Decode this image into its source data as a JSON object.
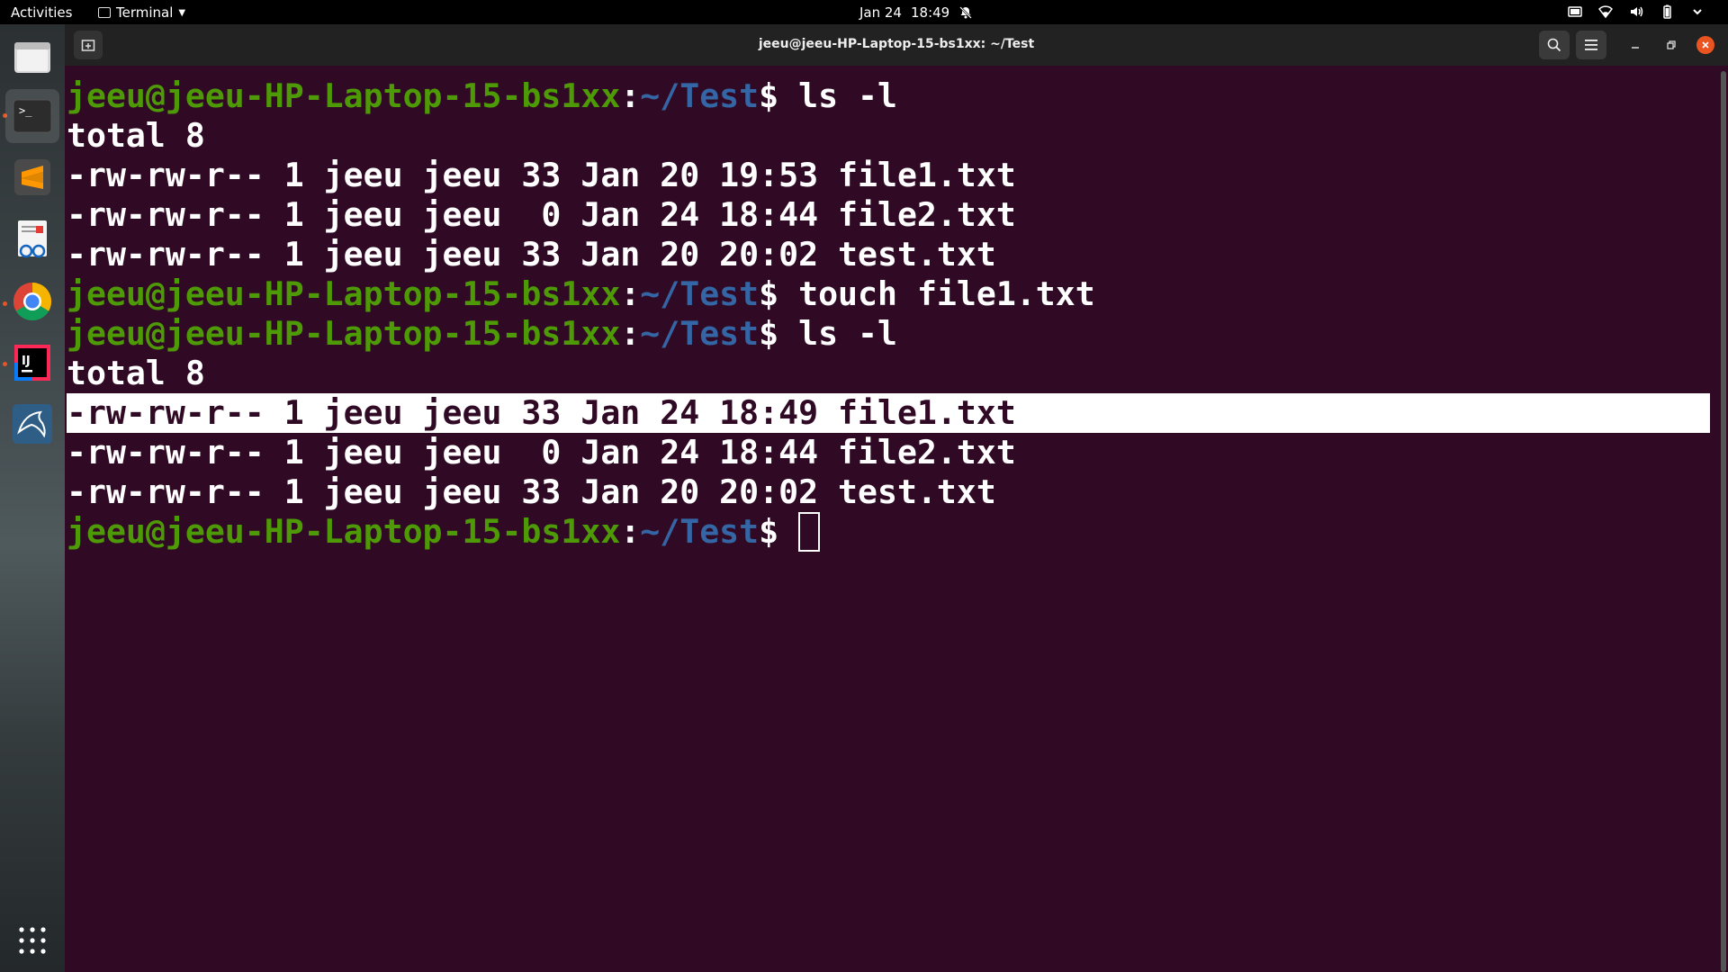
{
  "topbar": {
    "activities": "Activities",
    "app_name": "Terminal",
    "date": "Jan 24",
    "time": "18:49"
  },
  "dock": {
    "items": [
      {
        "name": "files",
        "icon": "folder-icon"
      },
      {
        "name": "terminal",
        "icon": "terminal-icon",
        "active": true
      },
      {
        "name": "sublime-text",
        "icon": "sublime-icon"
      },
      {
        "name": "document-viewer",
        "icon": "document-viewer-icon"
      },
      {
        "name": "chrome",
        "icon": "chrome-icon"
      },
      {
        "name": "intellij",
        "icon": "intellij-icon"
      },
      {
        "name": "mysql-workbench",
        "icon": "dolphin-icon"
      },
      {
        "name": "show-applications",
        "icon": "app-grid-icon"
      }
    ]
  },
  "window": {
    "title": "jeeu@jeeu-HP-Laptop-15-bs1xx: ~/Test"
  },
  "terminal": {
    "prompt_user": "jeeu@jeeu-HP-Laptop-15-bs1xx",
    "prompt_sep": ":",
    "prompt_path": "~/Test",
    "prompt_dollar": "$",
    "colors": {
      "background": "#300a24",
      "text": "#ffffff",
      "user": "#4e9a06",
      "path": "#3465a4"
    },
    "lines": [
      {
        "type": "prompt",
        "cmd": " ls -l"
      },
      {
        "type": "out",
        "text": "total 8"
      },
      {
        "type": "out",
        "text": "-rw-rw-r-- 1 jeeu jeeu 33 Jan 20 19:53 file1.txt"
      },
      {
        "type": "out",
        "text": "-rw-rw-r-- 1 jeeu jeeu  0 Jan 24 18:44 file2.txt"
      },
      {
        "type": "out",
        "text": "-rw-rw-r-- 1 jeeu jeeu 33 Jan 20 20:02 test.txt"
      },
      {
        "type": "prompt",
        "cmd": " touch file1.txt"
      },
      {
        "type": "prompt",
        "cmd": " ls -l"
      },
      {
        "type": "out",
        "text": "total 8"
      },
      {
        "type": "out",
        "text": "-rw-rw-r-- 1 jeeu jeeu 33 Jan 24 18:49 file1.txt",
        "highlight": true
      },
      {
        "type": "out",
        "text": "-rw-rw-r-- 1 jeeu jeeu  0 Jan 24 18:44 file2.txt"
      },
      {
        "type": "out",
        "text": "-rw-rw-r-- 1 jeeu jeeu 33 Jan 20 20:02 test.txt"
      },
      {
        "type": "prompt",
        "cmd": " ",
        "cursor": true
      }
    ]
  }
}
